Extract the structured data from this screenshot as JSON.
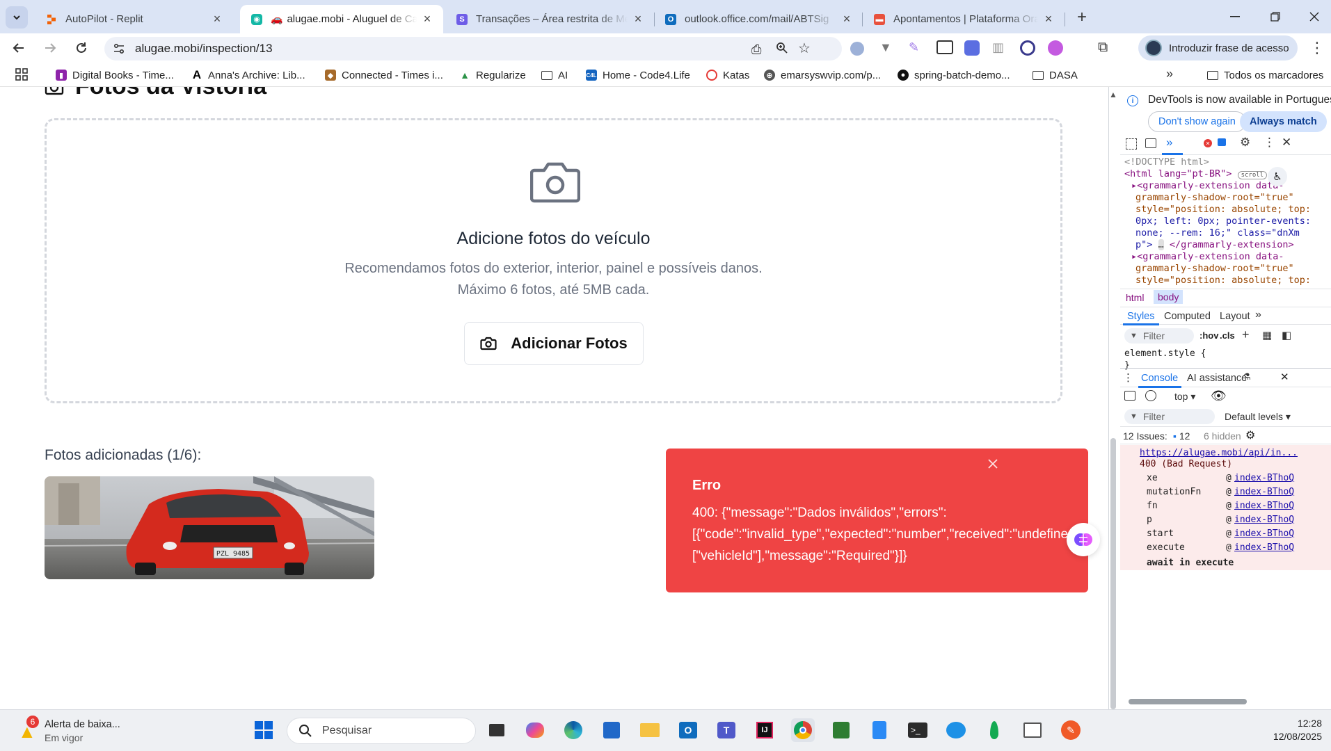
{
  "browser": {
    "tabs": [
      {
        "title": "AutoPilot - Replit",
        "active": false,
        "favicon": "replit-icon"
      },
      {
        "title": "alugae.mobi - Aluguel de Carros",
        "active": true,
        "favicon": "alugae-icon"
      },
      {
        "title": "Transações – Área restrita de Membros",
        "active": false,
        "favicon": "s-icon"
      },
      {
        "title": "outlook.office.com/mail/ABTSig",
        "active": false,
        "favicon": "outlook-icon"
      },
      {
        "title": "Apontamentos | Plataforma Oracle",
        "active": false,
        "favicon": "apontamentos-icon"
      }
    ],
    "new_tab": "+",
    "url": "alugae.mobi/inspection/13",
    "passkey_label": "Introduzir frase de acesso",
    "bookmarks": [
      {
        "label": "Digital Books - Time...",
        "icon": "book-icon"
      },
      {
        "label": "Anna's Archive: Lib...",
        "icon": "anna-icon"
      },
      {
        "label": "Connected - Times i...",
        "icon": "connected-icon"
      },
      {
        "label": "Regularize",
        "icon": "regularize-icon"
      },
      {
        "label": "AI",
        "icon": "folder-icon"
      },
      {
        "label": "Home - Code4.Life",
        "icon": "code4-icon"
      },
      {
        "label": "Katas",
        "icon": "katas-icon"
      },
      {
        "label": "emarsyswvip.com/p...",
        "icon": "globe-icon"
      },
      {
        "label": "spring-batch-demo...",
        "icon": "github-icon"
      },
      {
        "label": "DASA",
        "icon": "folder-icon"
      }
    ],
    "all_bookmarks": "Todos os marcadores"
  },
  "page": {
    "section_title": "Fotos da Vistoria",
    "dropzone_title": "Adicione fotos do veículo",
    "dropzone_line1": "Recomendamos fotos do exterior, interior, painel e possíveis danos.",
    "dropzone_line2": "Máximo 6 fotos, até 5MB cada.",
    "add_button": "Adicionar Fotos",
    "added_label": "Fotos adicionadas (1/6):",
    "photo_plate": "PZL 9485"
  },
  "toast": {
    "title": "Erro",
    "line1": "400: {\"message\":\"Dados inválidos\",\"errors\":",
    "line2": "[{\"code\":\"invalid_type\",\"expected\":\"number\",\"received\":\"undefined\",\"path\":",
    "line3": "[\"vehicleId\"],\"message\":\"Required\"}]}"
  },
  "devtools": {
    "banner_text": "DevTools is now available in Portuguese",
    "dont_show": "Don't show again",
    "always_match": "Always match",
    "dom_lines": [
      "<!DOCTYPE html>",
      "<html lang=\"pt-BR\">",
      "<grammarly-extension data-",
      "grammarly-shadow-root=\"true\"",
      "style=\"position: absolute; top:",
      "0px; left: 0px; pointer-events:",
      "none; --rem: 16;\" class=\"dnXm",
      "p\">",
      "</grammarly-extension>",
      "<grammarly-extension data-",
      "grammarly-shadow-root=\"true\"",
      "style=\"position: absolute; top:"
    ],
    "scroll_badge": "scroll",
    "breadcrumb_html": "html",
    "breadcrumb_body": "body",
    "styles_tab": "Styles",
    "computed_tab": "Computed",
    "layout_tab": "Layout",
    "filter_placeholder": "Filter",
    "hov": ":hov",
    "cls": ".cls",
    "element_style": "element.style {",
    "close_brace": "}",
    "console_tab": "Console",
    "ai_tab": "AI assistance",
    "context": "top",
    "default_levels": "Default levels",
    "issues_label": "12 Issues:",
    "issues_count": "12",
    "hidden_count": "6 hidden",
    "error_url": "https://alugae.mobi/api/in...",
    "error_status": "400 (Bad Request)",
    "stack": [
      {
        "fn": "xe",
        "src": "index-BThoQ"
      },
      {
        "fn": "mutationFn",
        "src": "index-BThoQ"
      },
      {
        "fn": "fn",
        "src": "index-BThoQ"
      },
      {
        "fn": "p",
        "src": "index-BThoQ"
      },
      {
        "fn": "start",
        "src": "index-BThoQ"
      },
      {
        "fn": "execute",
        "src": "index-BThoQ"
      }
    ],
    "await_label": "await in execute",
    "at_sign": "@"
  },
  "taskbar": {
    "alert_title": "Alerta de baixa...",
    "alert_sub": "Em vigor",
    "alert_badge": "6",
    "search_placeholder": "Pesquisar",
    "time": "12:28",
    "date": "12/08/2025"
  },
  "colors": {
    "toast_bg": "#ef4444",
    "tab_strip": "#dbe4f5",
    "devtools_accent": "#1a73e8"
  }
}
